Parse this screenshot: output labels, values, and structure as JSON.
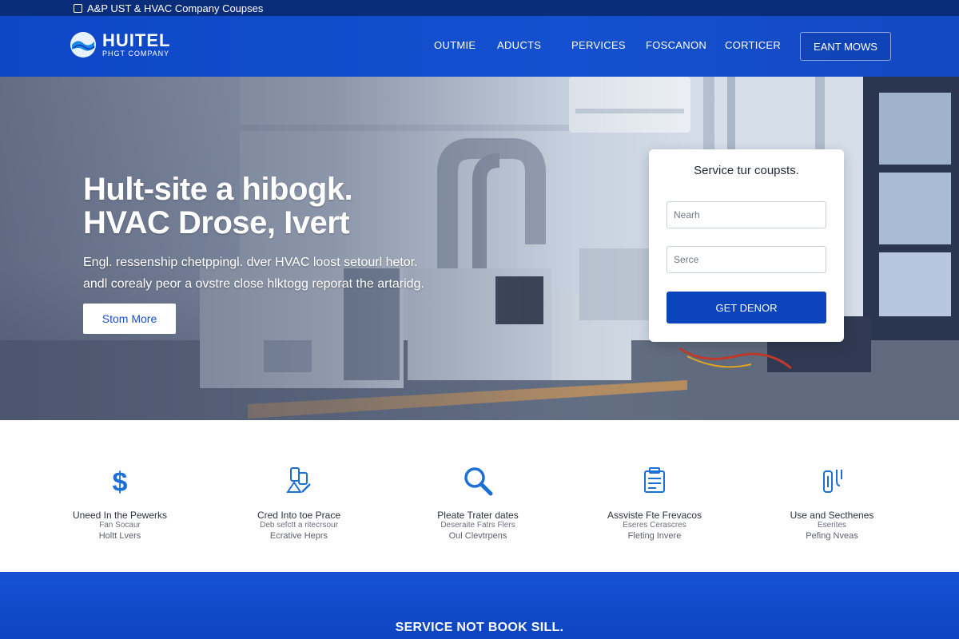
{
  "topbar": {
    "text": "A&P UST & HVAC Company Coupses"
  },
  "logo": {
    "name": "HUITEL",
    "subtitle": "PHGT COMPANY"
  },
  "nav": {
    "items": [
      "OUTMIE",
      "ADUCTS",
      "PERVICES",
      "FOSCANON",
      "CORTICER"
    ],
    "cta": "EANT MOWS"
  },
  "hero": {
    "title_line1": "Hult-site a hibogk.",
    "title_line2": "HVAC Drose, Ivert",
    "body_line1": "Engl. ressenship chetppingl. dver HVAC loost setourl hetor.",
    "body_line2": "andl corealy peor a ovstre close hlktogg reporat the artaridg.",
    "button": "Stom More"
  },
  "form": {
    "title": "Service tur coupsts.",
    "field1_placeholder": "Nearh",
    "field2_placeholder": "Serce",
    "button": "GET DENOR"
  },
  "features": [
    {
      "icon": "dollar-icon",
      "title": "Uneed In the Pewerks",
      "line1": "Fan Socaur",
      "line2": "Holtt Lvers"
    },
    {
      "icon": "tools-icon",
      "title": "Cred Into toe Prace",
      "line1": "Deb sefctt a ritecrsour",
      "line2": "Ecrative Heprs"
    },
    {
      "icon": "magnifier-icon",
      "title": "Pleate Trater dates",
      "line1": "Deseraite Fatrs Flers",
      "line2": "Oul Clevtrpens"
    },
    {
      "icon": "clipboard-icon",
      "title": "Assviste Fte Frevacos",
      "line1": "Eseres Cerascres",
      "line2": "Fleting Invere"
    },
    {
      "icon": "thermostat-icon",
      "title": "Use and Secthenes",
      "line1": "Eserites",
      "line2": "Pefing Nveas"
    }
  ],
  "band": {
    "text": "SERVICE NOT BOOK SILL."
  },
  "colors": {
    "brand_blue": "#0d47c6",
    "dark_blue": "#0a2d7a",
    "icon_blue": "#1d6fd8"
  }
}
